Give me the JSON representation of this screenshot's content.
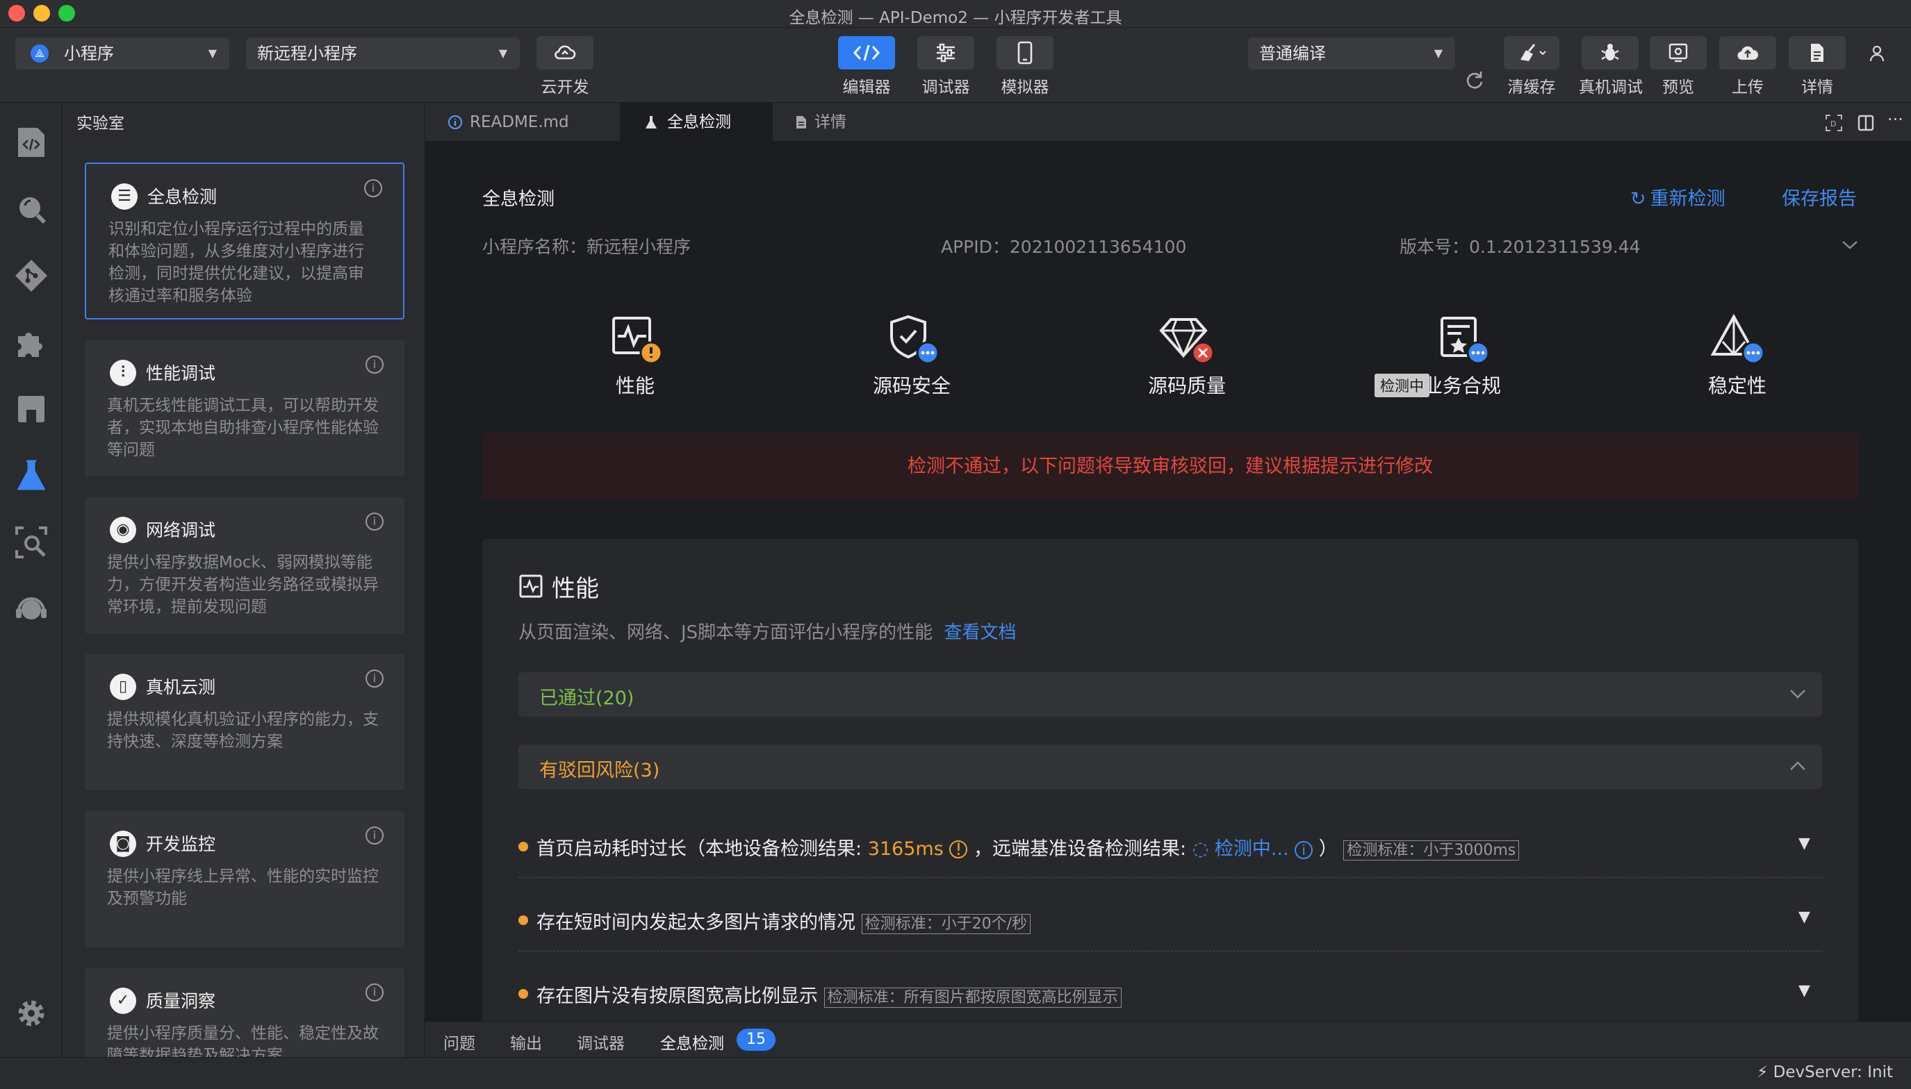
{
  "window": {
    "title": "全息检测 — API-Demo2 — 小程序开发者工具"
  },
  "toolbar": {
    "mode_select": "小程序",
    "project_select": "新远程小程序",
    "cloud_label": "云开发",
    "editor_label": "编辑器",
    "debugger_label": "调试器",
    "simulator_label": "模拟器",
    "compile_select": "普通编译",
    "clear_cache_label": "清缓存",
    "remote_debug_label": "真机调试",
    "preview_label": "预览",
    "upload_label": "上传",
    "details_label": "详情"
  },
  "sidebar": {
    "title": "实验室",
    "cards": [
      {
        "title": "全息检测",
        "desc": "识别和定位小程序运行过程中的质量和体验问题，从多维度对小程序进行检测，同时提供优化建议，以提高审核通过率和服务体验"
      },
      {
        "title": "性能调试",
        "desc": "真机无线性能调试工具，可以帮助开发者，实现本地自助排查小程序性能体验等问题"
      },
      {
        "title": "网络调试",
        "desc": "提供小程序数据Mock、弱网模拟等能力，方便开发者构造业务路径或模拟异常环境，提前发现问题"
      },
      {
        "title": "真机云测",
        "desc": "提供规模化真机验证小程序的能力，支持快速、深度等检测方案"
      },
      {
        "title": "开发监控",
        "desc": "提供小程序线上异常、性能的实时监控及预警功能"
      },
      {
        "title": "质量洞察",
        "desc": "提供小程序质量分、性能、稳定性及故障等数据趋势及解决方案"
      }
    ]
  },
  "tabs": [
    {
      "label": "README.md"
    },
    {
      "label": "全息检测"
    },
    {
      "label": "详情"
    }
  ],
  "report": {
    "title": "全息检测",
    "recheck": "重新检测",
    "save": "保存报告",
    "app_name": "小程序名称：新远程小程序",
    "appid": "APPID：2021002113654100",
    "version": "版本号：0.1.2012311539.44",
    "categories": [
      {
        "label": "性能",
        "status": "warning"
      },
      {
        "label": "源码安全",
        "status": "checking"
      },
      {
        "label": "源码质量",
        "status": "failed"
      },
      {
        "label": "业务合规",
        "status": "checking"
      },
      {
        "label": "稳定性",
        "status": "checking"
      }
    ],
    "tooltip": "检测中",
    "fail_banner": "检测不通过，以下问题将导致审核驳回，建议根据提示进行修改",
    "section": {
      "title": "性能",
      "desc": "从页面渲染、网络、JS脚本等方面评估小程序的性能",
      "doc_link": "查看文档",
      "passed": "已通过(20)",
      "risk": "有驳回风险(3)",
      "items": [
        {
          "text": "首页启动耗时过长（本地设备检测结果:",
          "value": "3165ms",
          "text2": "，远端基准设备检测结果:",
          "checking": "检测中...",
          "text3": "）",
          "standard": "检测标准：小于3000ms"
        },
        {
          "text": "存在短时间内发起太多图片请求的情况",
          "standard": "检测标准：小于20个/秒"
        },
        {
          "text": "存在图片没有按原图宽高比例显示",
          "standard": "检测标准：所有图片都按原图宽高比例显示"
        }
      ]
    }
  },
  "bottom_panel": {
    "tabs": [
      "问题",
      "输出",
      "调试器",
      "全息检测"
    ],
    "badge": "15"
  },
  "status": {
    "devserver": "DevServer: Init"
  },
  "colors": {
    "accent": "#2f7cf5",
    "danger": "#e5463c",
    "warning": "#f0a030",
    "success": "#7cc04a",
    "banner_bg": "#2a1c1e"
  }
}
